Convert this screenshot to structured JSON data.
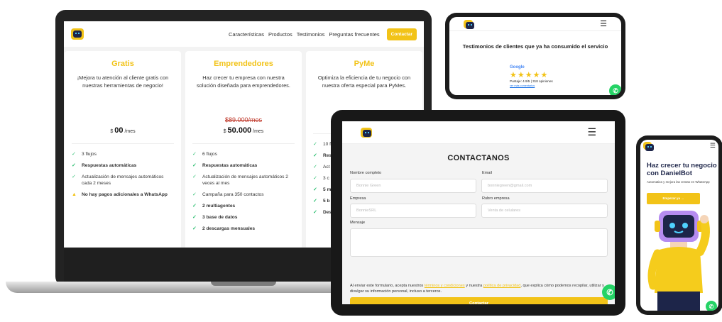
{
  "laptop": {
    "nav": {
      "links": [
        "Características",
        "Productos",
        "Testimonios",
        "Preguntas frecuentes"
      ],
      "cta": "Contactar"
    },
    "plans": [
      {
        "name": "Gratis",
        "description": "¡Mejora tu atención al cliente gratis con nuestras herramientas de negocio!",
        "old_price": "",
        "currency": "$",
        "price": "00",
        "period": "/mes",
        "features": [
          {
            "text": "3 flujos",
            "bold": false,
            "warn": false
          },
          {
            "text": "Respuestas automáticas",
            "bold": true,
            "warn": false
          },
          {
            "text": "Actualización de mensajes automáticos cada 2 meses",
            "bold": false,
            "warn": false
          },
          {
            "text": "No hay pagos adicionales a WhatsApp",
            "bold": true,
            "warn": true
          }
        ]
      },
      {
        "name": "Emprendedores",
        "description": "Haz crecer tu empresa con nuestra solución diseñada para emprendedores.",
        "old_price": "$89.000/mes",
        "currency": "$",
        "price": "50.000",
        "period": "/mes",
        "features": [
          {
            "text": "6 flujos",
            "bold": false,
            "warn": false
          },
          {
            "text": "Respuestas automáticas",
            "bold": true,
            "warn": false
          },
          {
            "text": "Actualización de mensajes automáticos 2 veces al mes",
            "bold": false,
            "warn": false
          },
          {
            "text": "Campaña para 350 contactos",
            "bold": false,
            "warn": false
          },
          {
            "text": "2 multiagentes",
            "bold": true,
            "warn": false
          },
          {
            "text": "3 base de datos",
            "bold": true,
            "warn": false
          },
          {
            "text": "2 descargas mensuales",
            "bold": true,
            "warn": false
          }
        ]
      },
      {
        "name": "PyMe",
        "description": "Optimiza la eficiencia de tu negocio con nuestra oferta especial para PyMes.",
        "old_price": "",
        "currency": "",
        "price": "",
        "period": "",
        "features": [
          {
            "text": "10 f",
            "bold": false,
            "warn": false
          },
          {
            "text": "Res",
            "bold": true,
            "warn": false
          },
          {
            "text": "Act aut",
            "bold": false,
            "warn": false
          },
          {
            "text": "3 c por",
            "bold": false,
            "warn": false
          },
          {
            "text": "5 m",
            "bold": true,
            "warn": false
          },
          {
            "text": "5 b",
            "bold": true,
            "warn": false
          },
          {
            "text": "Des",
            "bold": true,
            "warn": false
          }
        ]
      }
    ]
  },
  "phone_landscape": {
    "title": "Testimonios de clientes que ya ha consumido el servicio",
    "google_label": "Google",
    "stars": "★★★★★",
    "score": "Puntaje: 4.9/5 | 318 opiniones",
    "link": "ver más comentarios"
  },
  "tablet": {
    "title": "CONTACTANOS",
    "fields": {
      "name_label": "Nombre completo",
      "name_placeholder": "Bonnie Green",
      "email_label": "Email",
      "email_placeholder": "bonniegreen@gmail.com",
      "company_label": "Empresa",
      "company_placeholder": "BonnieSRL",
      "industry_label": "Rubro empresa",
      "industry_placeholder": "Venta de celulares",
      "message_label": "Mensaje"
    },
    "legal": {
      "p1": "Al enviar este formulario, acepta nuestros ",
      "terms": "términos y condiciones",
      "p2": " y nuestra ",
      "privacy": "política de privacidad",
      "p3": ", que explica cómo podemos recopilar, utilizar y divulgar su información personal, incluso a terceros."
    },
    "submit": "Contactar"
  },
  "phone_portrait": {
    "headline": "Haz crecer tu negocio con DanielBot",
    "subtext": "Automatiza y mejora las ventas en WhatsApp",
    "cta": "Empezar ya →"
  },
  "colors": {
    "accent": "#f2c318",
    "navy": "#1d2549",
    "whatsapp": "#25d366",
    "check": "#2bbf70"
  },
  "icons": [
    "bot-logo-icon",
    "hamburger-menu-icon",
    "whatsapp-icon",
    "check-icon",
    "warning-icon",
    "star-icon"
  ]
}
